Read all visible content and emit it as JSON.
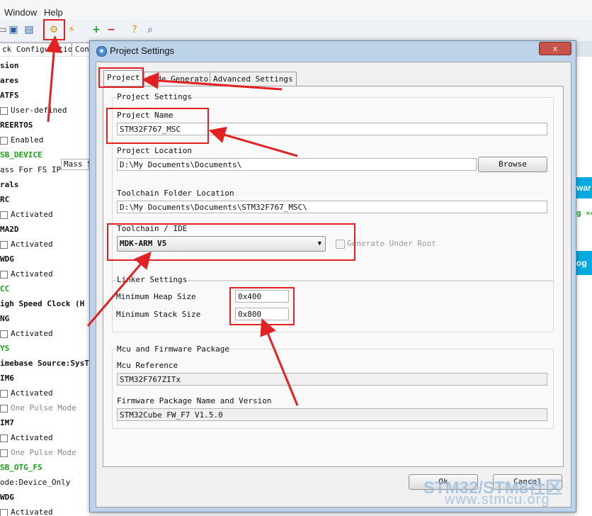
{
  "menubar": {
    "items": [
      "Window",
      "Help"
    ]
  },
  "toolbar": {
    "icons": [
      "open-folder-icon",
      "save-icon",
      "save-all-icon",
      "generate-code-icon",
      "gear-tools-icon",
      "add-icon",
      "remove-icon",
      "help-icon",
      "search-icon"
    ]
  },
  "background": {
    "tabs": [
      "ck Configuration",
      "Con"
    ],
    "tree": [
      {
        "text": "sion",
        "style": "bold"
      },
      {
        "text": "ares",
        "style": "bold"
      },
      {
        "text": "ATFS",
        "style": "bold"
      },
      {
        "text": "User-defined",
        "style": "check"
      },
      {
        "text": "REERTOS",
        "style": "bold"
      },
      {
        "text": "Enabled",
        "style": "check"
      },
      {
        "text": "SB_DEVICE",
        "style": "green"
      },
      {
        "text": "ass For FS IP",
        "style": "plain"
      },
      {
        "text": "rals",
        "style": "bold"
      },
      {
        "text": "RC",
        "style": "bold"
      },
      {
        "text": "Activated",
        "style": "check"
      },
      {
        "text": "MA2D",
        "style": "bold"
      },
      {
        "text": "Activated",
        "style": "check"
      },
      {
        "text": "WDG",
        "style": "bold"
      },
      {
        "text": "Activated",
        "style": "check"
      },
      {
        "text": "CC",
        "style": "green"
      },
      {
        "text": "igh Speed Clock (H",
        "style": "bold"
      },
      {
        "text": "NG",
        "style": "bold"
      },
      {
        "text": "Activated",
        "style": "check"
      },
      {
        "text": "YS",
        "style": "green"
      },
      {
        "text": "imebase Source:SysT",
        "style": "bold"
      },
      {
        "text": "IM6",
        "style": "bold"
      },
      {
        "text": "Activated",
        "style": "check"
      },
      {
        "text": "One Pulse Mode",
        "style": "checkdim"
      },
      {
        "text": "IM7",
        "style": "bold"
      },
      {
        "text": "Activated",
        "style": "check"
      },
      {
        "text": "One Pulse Mode",
        "style": "checkdim"
      },
      {
        "text": "SB_OTG_FS",
        "style": "green"
      },
      {
        "text": "ode:Device_Only",
        "style": "plain"
      },
      {
        "text": "WDG",
        "style": "bold"
      },
      {
        "text": "Activated",
        "style": "check"
      }
    ],
    "mass_field": "Mass S",
    "right_buttons": [
      "war",
      "og"
    ],
    "right_link": "g «←"
  },
  "dialog": {
    "title": "Project Settings",
    "close_label": "x",
    "tabs": [
      "Project",
      "Code Generator",
      "Advanced Settings"
    ],
    "project_settings": {
      "legend": "Project Settings",
      "project_name_label": "Project Name",
      "project_name": "STM32F767_MSC",
      "project_location_label": "Project Location",
      "project_location": "D:\\My Documents\\Documents\\",
      "browse_label": "Browse",
      "toolchain_folder_label": "Toolchain Folder Location",
      "toolchain_folder": "D:\\My Documents\\Documents\\STM32F767_MSC\\",
      "toolchain_label": "Toolchain / IDE",
      "toolchain_value": "MDK-ARM V5",
      "generate_under_root": "Generate Under Root"
    },
    "linker": {
      "legend": "Linker Settings",
      "heap_label": "Minimum Heap Size",
      "heap_value": "0x400",
      "stack_label": "Minimum Stack Size",
      "stack_value": "0x800"
    },
    "mcu": {
      "legend": "Mcu and Firmware Package",
      "ref_label": "Mcu Reference",
      "ref_value": "STM32F767ZITx",
      "fw_label": "Firmware Package Name and Version",
      "fw_value": "STM32Cube FW_F7 V1.5.0"
    },
    "ok_label": "Ok",
    "cancel_label": "Cancel"
  },
  "watermark": {
    "line1": "STM32/STM8社区",
    "line2": "www.stmcu.org"
  },
  "colors": {
    "annotation": "#e22222",
    "accent": "#03a9e0",
    "green": "#19a319"
  }
}
